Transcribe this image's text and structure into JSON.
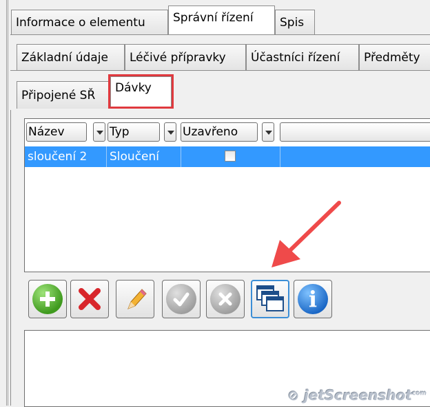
{
  "tabs_row1": [
    "Informace o elementu",
    "Správní řízení",
    "Spis"
  ],
  "tabs_row2": [
    "Základní údaje",
    "Léčivé přípravky",
    "Účastníci řízení",
    "Předměty"
  ],
  "tabs_row3": [
    "Připojené SŘ",
    "Dávky"
  ],
  "active": {
    "row1": "Správní řízení",
    "row3": "Dávky"
  },
  "grid": {
    "columns": [
      "Název",
      "Typ",
      "Uzavřeno"
    ],
    "rows": [
      {
        "nazev": "sloučení 2",
        "typ": "Sloučení",
        "uzavreno": false
      }
    ]
  },
  "toolbar": [
    "add-icon",
    "delete-icon",
    "edit-icon",
    "confirm-icon",
    "cancel-icon",
    "windows-icon",
    "info-icon"
  ],
  "colors": {
    "selection": "#3399ff",
    "highlight": "#e0393e",
    "arrow": "#ef4a4a"
  },
  "watermark": "jetScreenshot",
  "watermark_small": "com"
}
